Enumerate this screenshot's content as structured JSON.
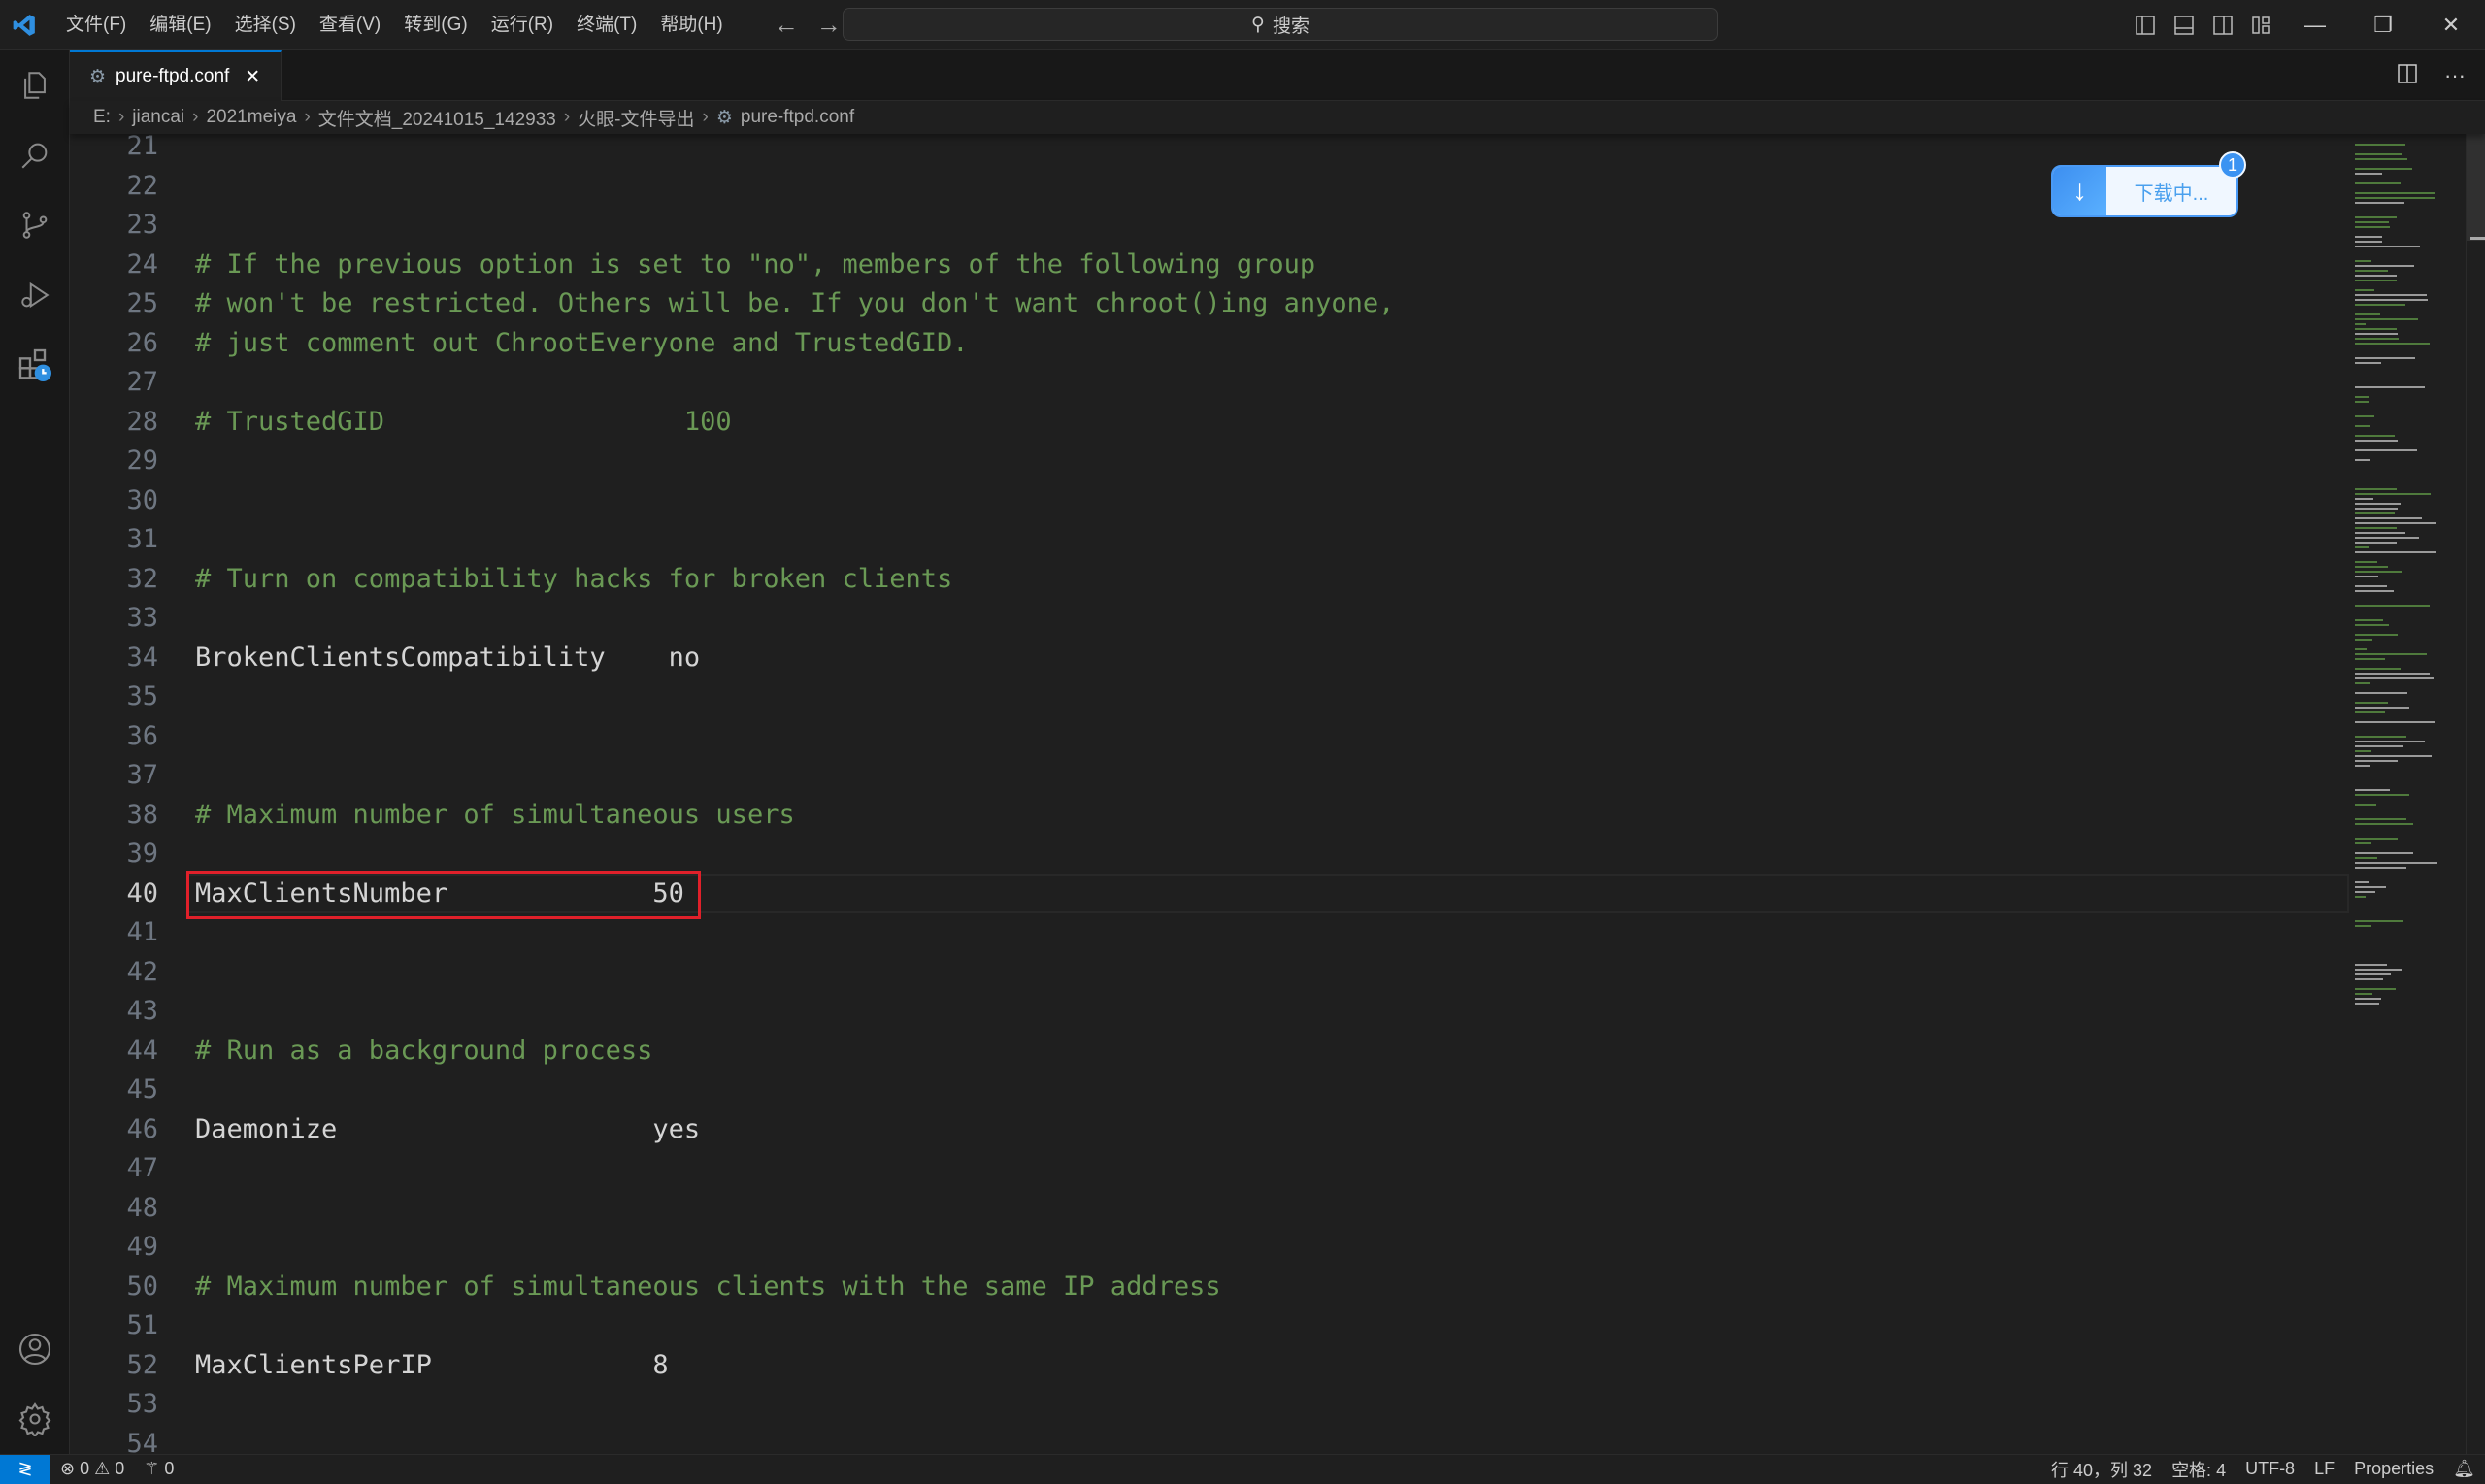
{
  "titlebar": {
    "menu": [
      "文件(F)",
      "编辑(E)",
      "选择(S)",
      "查看(V)",
      "转到(G)",
      "运行(R)",
      "终端(T)",
      "帮助(H)"
    ],
    "search_placeholder": "搜索"
  },
  "tab": {
    "label": "pure-ftpd.conf"
  },
  "breadcrumb": [
    "E:",
    "jiancai",
    "2021meiya",
    "文件文档_20241015_142933",
    "火眼-文件导出",
    "pure-ftpd.conf"
  ],
  "editor": {
    "current_line": 40,
    "lines": [
      {
        "n": "21",
        "text": "",
        "type": "code"
      },
      {
        "n": "22",
        "text": "",
        "type": "code"
      },
      {
        "n": "23",
        "text": "",
        "type": "code"
      },
      {
        "n": "24",
        "text": "# If the previous option is set to \"no\", members of the following group",
        "type": "comment"
      },
      {
        "n": "25",
        "text": "# won't be restricted. Others will be. If you don't want chroot()ing anyone,",
        "type": "comment"
      },
      {
        "n": "26",
        "text": "# just comment out ChrootEveryone and TrustedGID.",
        "type": "comment"
      },
      {
        "n": "27",
        "text": "",
        "type": "code"
      },
      {
        "n": "28",
        "text": "# TrustedGID                   100",
        "type": "comment"
      },
      {
        "n": "29",
        "text": "",
        "type": "code"
      },
      {
        "n": "30",
        "text": "",
        "type": "code"
      },
      {
        "n": "31",
        "text": "",
        "type": "code"
      },
      {
        "n": "32",
        "text": "# Turn on compatibility hacks for broken clients",
        "type": "comment"
      },
      {
        "n": "33",
        "text": "",
        "type": "code"
      },
      {
        "n": "34",
        "text": "BrokenClientsCompatibility    no",
        "type": "code"
      },
      {
        "n": "35",
        "text": "",
        "type": "code"
      },
      {
        "n": "36",
        "text": "",
        "type": "code"
      },
      {
        "n": "37",
        "text": "",
        "type": "code"
      },
      {
        "n": "38",
        "text": "# Maximum number of simultaneous users",
        "type": "comment"
      },
      {
        "n": "39",
        "text": "",
        "type": "code"
      },
      {
        "n": "40",
        "text": "MaxClientsNumber             50",
        "type": "code"
      },
      {
        "n": "41",
        "text": "",
        "type": "code"
      },
      {
        "n": "42",
        "text": "",
        "type": "code"
      },
      {
        "n": "43",
        "text": "",
        "type": "code"
      },
      {
        "n": "44",
        "text": "# Run as a background process",
        "type": "comment"
      },
      {
        "n": "45",
        "text": "",
        "type": "code"
      },
      {
        "n": "46",
        "text": "Daemonize                    yes",
        "type": "code"
      },
      {
        "n": "47",
        "text": "",
        "type": "code"
      },
      {
        "n": "48",
        "text": "",
        "type": "code"
      },
      {
        "n": "49",
        "text": "",
        "type": "code"
      },
      {
        "n": "50",
        "text": "# Maximum number of simultaneous clients with the same IP address",
        "type": "comment"
      },
      {
        "n": "51",
        "text": "",
        "type": "code"
      },
      {
        "n": "52",
        "text": "MaxClientsPerIP              8",
        "type": "code"
      },
      {
        "n": "53",
        "text": "",
        "type": "code"
      },
      {
        "n": "54",
        "text": "",
        "type": "code"
      }
    ]
  },
  "download": {
    "label": "下载中...",
    "badge": "1"
  },
  "statusbar": {
    "errors": "0",
    "warnings": "0",
    "ports": "0",
    "position": "行 40，列 32",
    "spaces": "空格: 4",
    "encoding": "UTF-8",
    "eol": "LF",
    "language": "Properties"
  },
  "colors": {
    "accent": "#0078d4",
    "comment": "#6a9955",
    "highlight": "#e0202a",
    "download": "#3b93f2"
  }
}
